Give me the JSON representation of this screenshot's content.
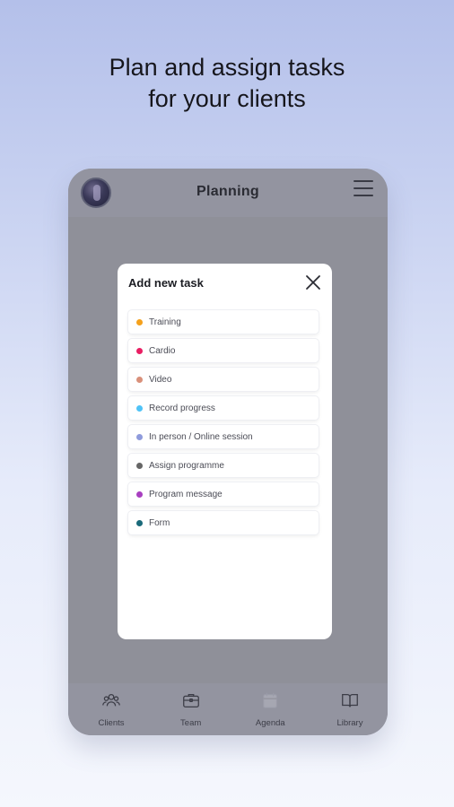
{
  "headline": {
    "line1": "Plan and assign tasks",
    "line2": "for your clients"
  },
  "app": {
    "header": {
      "title": "Planning",
      "avatar_icon": "user-avatar",
      "menu_icon": "hamburger-menu-icon"
    },
    "modal": {
      "title": "Add new task",
      "close_icon": "close-icon",
      "tasks": [
        {
          "label": "Training",
          "color": "#f5a11c"
        },
        {
          "label": "Cardio",
          "color": "#e91e63"
        },
        {
          "label": "Video",
          "color": "#d9907a"
        },
        {
          "label": "Record progress",
          "color": "#4fc3f7"
        },
        {
          "label": "In person / Online session",
          "color": "#8f9bdc"
        },
        {
          "label": "Assign programme",
          "color": "#666666"
        },
        {
          "label": "Program message",
          "color": "#a83fc0"
        },
        {
          "label": "Form",
          "color": "#1a6a7a"
        }
      ]
    },
    "bottom_nav": [
      {
        "label": "Clients",
        "icon": "clients-icon"
      },
      {
        "label": "Team",
        "icon": "briefcase-icon"
      },
      {
        "label": "Agenda",
        "icon": "calendar-icon"
      },
      {
        "label": "Library",
        "icon": "book-icon"
      }
    ]
  }
}
